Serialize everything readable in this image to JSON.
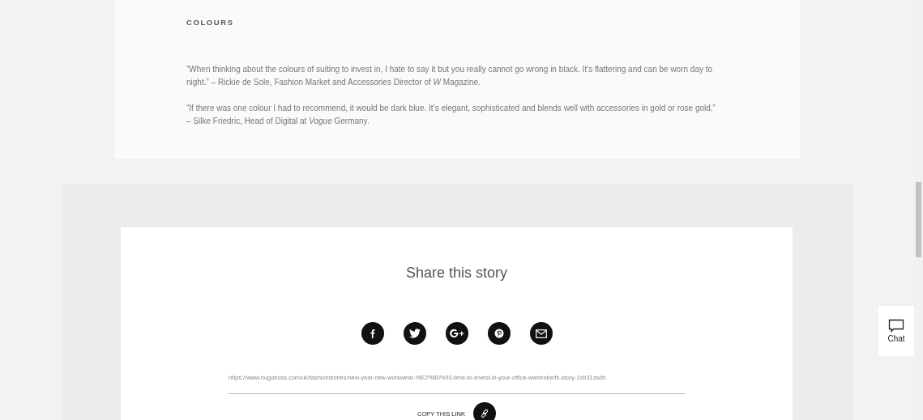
{
  "article": {
    "heading": "COLOURS",
    "quotes": [
      "“When thinking about the colours of suiting to invest in, I hate to say it but you really cannot go wrong in black. It’s flattering and can be worn day to night.” – Rickie de Sole, Fashion Market and Accessories Director of *W* Magazine.",
      "“If there was one colour I had to recommend, it would be dark blue. It’s elegant, sophisticated and blends well with accessories in gold or rose gold.” – Silke Friedric, Head of Digital at *Vogue* Germany."
    ]
  },
  "share": {
    "title": "Share this story",
    "buttons": [
      {
        "kind": "facebook"
      },
      {
        "kind": "twitter"
      },
      {
        "kind": "googleplus"
      },
      {
        "kind": "pinterest"
      },
      {
        "kind": "email"
      }
    ],
    "url": "https://www.hugoboss.com/uk/fashionstories/new-year-new-workwear-%E2%80%93-time-to-invest-in-your-office-wardrobe/fs-story-1xb31zsdb",
    "copy_label": "COPY THIS LINK"
  },
  "chat": {
    "label": "Chat"
  }
}
